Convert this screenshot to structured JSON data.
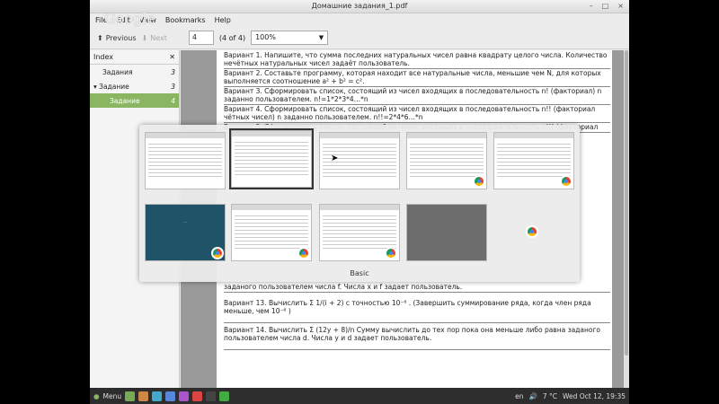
{
  "window": {
    "title": "Домашние задания_1.pdf",
    "controls": [
      "–",
      "□",
      "×"
    ]
  },
  "menu": {
    "items": [
      "File",
      "Edit",
      "View",
      "Bookmarks",
      "Help"
    ],
    "logo_text": "Google"
  },
  "toolbar": {
    "previous_label": "Previous",
    "next_label": "Next",
    "page_value": "4",
    "page_count": "(4 of 4)",
    "zoom_value": "100%"
  },
  "sidebar": {
    "title": "Index",
    "items": [
      {
        "label": "Задания",
        "num": "3"
      },
      {
        "label": "Задание",
        "num": "3"
      },
      {
        "label": "Задание",
        "num": "4"
      }
    ]
  },
  "document": {
    "lines": [
      "Вариант 1. Напишите, что сумма последних натуральных чисел равна квадрату целого числа. Количество нечётных натуральных чисел задаёт пользователь.",
      "Вариант 2. Составьте программу, которая находит все натуральные числа, меньшие чем N, для которых выполняется соотношение a² + b² = c².",
      "Вариант 3. Сформировать список, состоящий из чисел входящих в последовательность n! (факториал) n заданно пользователем. n!=1*2*3*4…*n",
      "Вариант 4. Сформировать список, состоящий из чисел входящих в последовательность n!! (факториал чётных чисел) n заданно пользователем. n!!=2*4*6…*n",
      "Вариант 5. Сформировать список, состоящий из чисел входящих в последовательность n!!! (факториал",
      "заданого пользователем числа f. Числа x и f задает пользователь.",
      "Вариант 13.   Вычислить  Σ 1/(i + 2)  с точностью 10⁻⁶ . (Завершить суммирование ряда, когда член ряда меньше, чем 10⁻⁶ )",
      "Вариант 14.   Вычислить  Σ (12y + 8)/n   Сумму вычислить до тех пор пока она меньше либо равна заданого пользователем числа d. Числа y и d задает пользователь."
    ]
  },
  "switcher": {
    "label": "Basic"
  },
  "taskbar": {
    "menu_label": "Menu",
    "language": "en",
    "temperature": "7 °C",
    "datetime": "Wed Oct 12, 19:35"
  }
}
